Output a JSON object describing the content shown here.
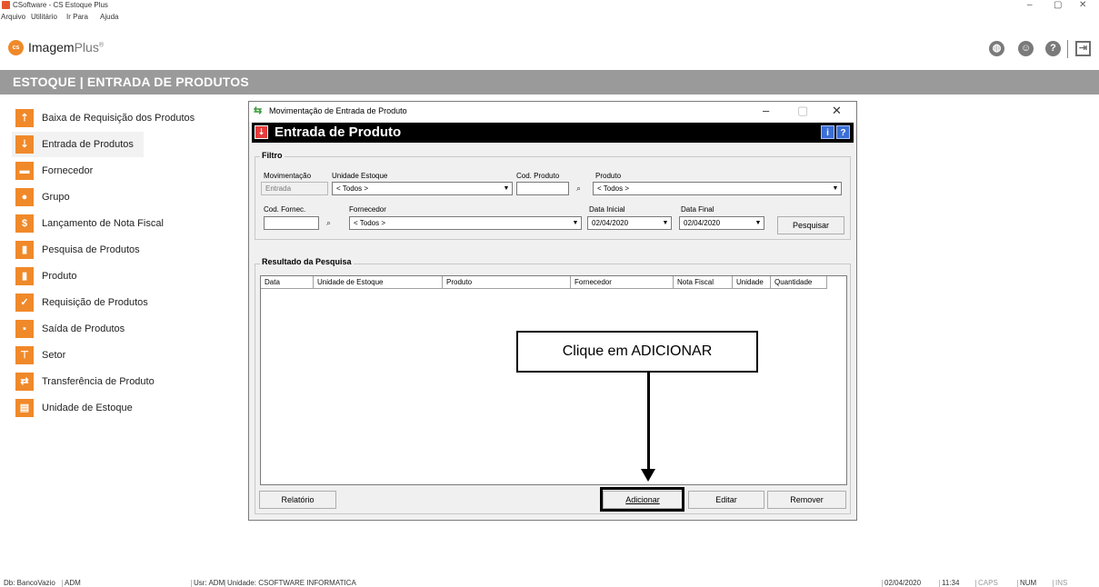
{
  "window": {
    "title": "CSoftware - CS Estoque Plus",
    "minimize": "–",
    "maximize": "▢",
    "close": "✕"
  },
  "menu": [
    "Arquivo",
    "Utilitário",
    "Ir Para",
    "Ajuda"
  ],
  "brand": {
    "logo": "cs",
    "name": "Imagem",
    "suffix": "Plus",
    "mark": "®"
  },
  "top_icons": [
    "globe-icon",
    "support-agent-icon",
    "help-icon",
    "exit-icon"
  ],
  "module_header": "ESTOQUE  |  ENTRADA DE PRODUTOS",
  "sidebar": {
    "items": [
      {
        "label": "Baixa de Requisição dos Produtos",
        "icon": "box-up-icon"
      },
      {
        "label": "Entrada de Produtos",
        "icon": "box-in-icon"
      },
      {
        "label": "Fornecedor",
        "icon": "truck-icon"
      },
      {
        "label": "Grupo",
        "icon": "group-icon"
      },
      {
        "label": "Lançamento de Nota Fiscal",
        "icon": "invoice-icon"
      },
      {
        "label": "Pesquisa de Produtos",
        "icon": "search-product-icon"
      },
      {
        "label": "Produto",
        "icon": "product-icon"
      },
      {
        "label": "Requisição de Produtos",
        "icon": "checklist-icon"
      },
      {
        "label": "Saída de Produtos",
        "icon": "box-out-icon"
      },
      {
        "label": "Setor",
        "icon": "org-chart-icon"
      },
      {
        "label": "Transferência de Produto",
        "icon": "transfer-icon"
      },
      {
        "label": "Unidade de Estoque",
        "icon": "stock-unit-icon"
      }
    ]
  },
  "dialog": {
    "title": "Movimentação de Entrada de Produto",
    "header": "Entrada de Produto",
    "filter": {
      "title": "Filtro",
      "movimentacao_label": "Movimentação",
      "movimentacao_value": "Entrada",
      "unidade_label": "Unidade Estoque",
      "unidade_value": "< Todos >",
      "cod_produto_label": "Cod. Produto",
      "cod_produto_value": "",
      "produto_label": "Produto",
      "produto_value": "< Todos >",
      "cod_fornec_label": "Cod. Fornec.",
      "cod_fornec_value": "",
      "fornecedor_label": "Fornecedor",
      "fornecedor_value": "< Todos >",
      "data_inicial_label": "Data Inicial",
      "data_inicial_value": "02/04/2020",
      "data_final_label": "Data Final",
      "data_final_value": "02/04/2020",
      "pesquisar": "Pesquisar"
    },
    "results": {
      "title": "Resultado da Pesquisa",
      "columns": [
        "Data",
        "Unidade de Estoque",
        "Produto",
        "Fornecedor",
        "Nota Fiscal",
        "Unidade",
        "Quantidade"
      ]
    },
    "buttons": {
      "relatorio": "Relatório",
      "adicionar": "Adicionar",
      "editar": "Editar",
      "remover": "Remover"
    }
  },
  "callout": "Clique em ADICIONAR",
  "status": {
    "db": "Db: BancoVazio",
    "user_short": "ADM",
    "usr": "Usr: ADM",
    "unidade": "Unidade: CSOFTWARE INFORMATICA",
    "date": "02/04/2020",
    "time": "11:34",
    "caps": "CAPS",
    "num": "NUM",
    "ins": "INS"
  }
}
